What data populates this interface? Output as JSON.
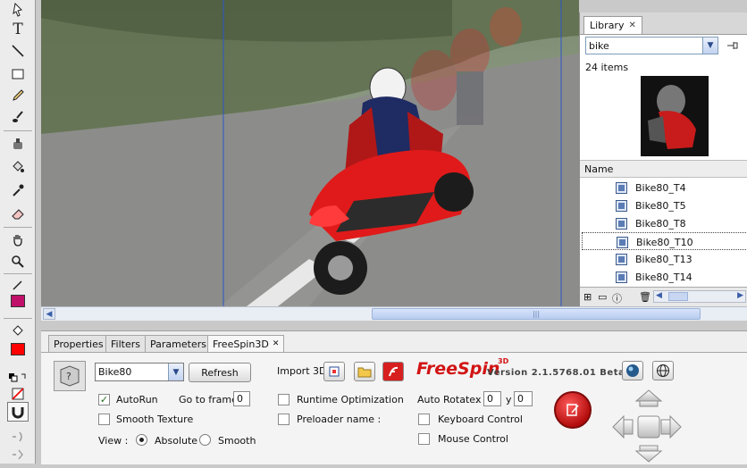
{
  "library": {
    "tab_label": "Library",
    "search_value": "bike",
    "item_count": "24 items",
    "column_name": "Name",
    "items": [
      "Bike80_T4",
      "Bike80_T5",
      "Bike80_T8",
      "Bike80_T10",
      "Bike80_T13",
      "Bike80_T14"
    ],
    "selected_item": "Bike80_T10"
  },
  "panel": {
    "tabs": [
      "Properties",
      "Filters",
      "Parameters",
      "FreeSpin3D"
    ],
    "active_tab": "FreeSpin3D",
    "model_select": "Bike80",
    "refresh_label": "Refresh",
    "import_label": "Import 3D",
    "autorun_label": "AutoRun",
    "autorun_checked": true,
    "goto_label": "Go to frame",
    "goto_value": "0",
    "smooth_texture_label": "Smooth Texture",
    "view_label": "View :",
    "view_options": [
      "Absolute",
      "Smooth"
    ],
    "view_selected": "Absolute",
    "runtime_opt_label": "Runtime Optimization",
    "preloader_label": "Preloader name :",
    "auto_rotate_label": "Auto Rotate:",
    "x_label": "x",
    "x_value": "0",
    "y_label": "y",
    "y_value": "0",
    "keyboard_label": "Keyboard Control",
    "mouse_label": "Mouse Control",
    "brand_text": "FreeSpin",
    "brand_sup": "3D",
    "version_text": "Version 2.1.5768.01 Beta"
  },
  "colors": {
    "stroke": "#c0106a",
    "fill": "#ff0000",
    "brand_red": "#d21414"
  },
  "icons": [
    "subselect-icon",
    "text-icon",
    "line-icon",
    "rectangle-icon",
    "pencil-icon",
    "brush-icon",
    "ink-bottle-icon",
    "paint-bucket-icon",
    "eyedropper-icon",
    "eraser-icon",
    "hand-icon",
    "zoom-icon"
  ]
}
